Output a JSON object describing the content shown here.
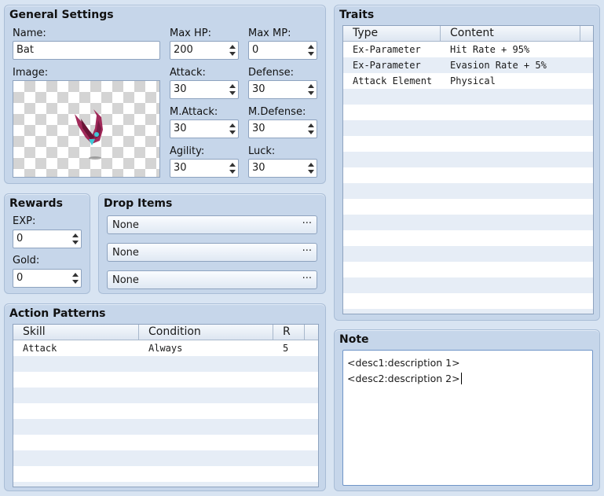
{
  "general": {
    "title": "General Settings",
    "name_label": "Name:",
    "name_value": "Bat",
    "image_label": "Image:",
    "maxhp_label": "Max HP:",
    "maxhp_value": "200",
    "maxmp_label": "Max MP:",
    "maxmp_value": "0",
    "attack_label": "Attack:",
    "attack_value": "30",
    "defense_label": "Defense:",
    "defense_value": "30",
    "matk_label": "M.Attack:",
    "matk_value": "30",
    "mdef_label": "M.Defense:",
    "mdef_value": "30",
    "agility_label": "Agility:",
    "agility_value": "30",
    "luck_label": "Luck:",
    "luck_value": "30"
  },
  "rewards": {
    "title": "Rewards",
    "exp_label": "EXP:",
    "exp_value": "0",
    "gold_label": "Gold:",
    "gold_value": "0"
  },
  "drop_items": {
    "title": "Drop Items",
    "items": [
      "None",
      "None",
      "None"
    ],
    "more": "···"
  },
  "action_patterns": {
    "title": "Action Patterns",
    "columns": [
      "Skill",
      "Condition",
      "R"
    ],
    "rows": [
      {
        "skill": "Attack",
        "condition": "Always",
        "r": "5"
      }
    ]
  },
  "traits": {
    "title": "Traits",
    "columns": [
      "Type",
      "Content"
    ],
    "rows": [
      {
        "type": "Ex-Parameter",
        "content": "Hit Rate + 95%"
      },
      {
        "type": "Ex-Parameter",
        "content": "Evasion Rate + 5%"
      },
      {
        "type": "Attack Element",
        "content": "Physical"
      }
    ]
  },
  "note": {
    "title": "Note",
    "lines": [
      "<desc1:description 1>",
      "<desc2:description 2>"
    ]
  }
}
